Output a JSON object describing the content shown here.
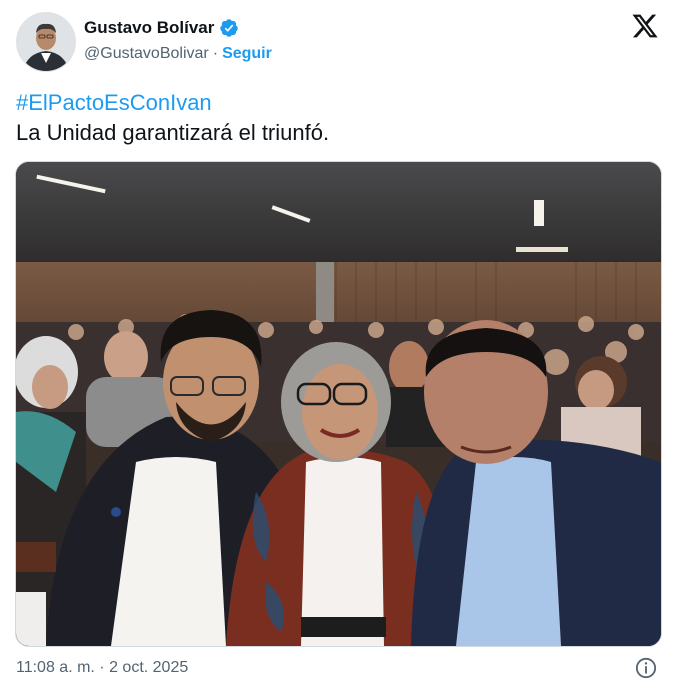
{
  "author": {
    "display_name": "Gustavo Bolívar",
    "handle": "@GustavoBolivar",
    "separator": "·",
    "follow_label": "Seguir",
    "verified_icon": "verified-badge-icon",
    "avatar_icon": "profile-photo"
  },
  "tweet": {
    "hashtag": "#ElPactoEsConIvan",
    "text": "La Unidad garantizará el triunfó.",
    "media_description_icon": "selfie-photo"
  },
  "footer": {
    "timestamp": "11:08 a. m. · 2 oct. 2025",
    "info_icon": "info-icon"
  },
  "colors": {
    "accent": "#1d9bf0",
    "text": "#0f1419",
    "muted": "#536471"
  }
}
